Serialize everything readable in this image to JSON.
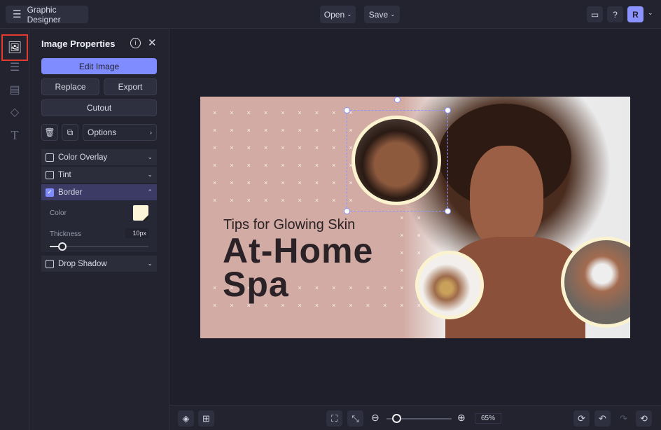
{
  "app": {
    "title": "Graphic Designer",
    "open": "Open",
    "save": "Save",
    "avatar": "R"
  },
  "panel": {
    "title": "Image Properties",
    "edit": "Edit Image",
    "replace": "Replace",
    "export": "Export",
    "cutout": "Cutout",
    "options": "Options",
    "effects": [
      {
        "label": "Color Overlay",
        "checked": false
      },
      {
        "label": "Tint",
        "checked": false
      },
      {
        "label": "Border",
        "checked": true
      },
      {
        "label": "Drop Shadow",
        "checked": false
      }
    ],
    "border": {
      "color_label": "Color",
      "color": "#fdf6d8",
      "thickness_label": "Thickness",
      "thickness": "10px",
      "thickness_value": 10
    }
  },
  "design": {
    "subtitle": "Tips for Glowing Skin",
    "title1": "At-Home",
    "title2": "Spa"
  },
  "zoom": {
    "value": "65%",
    "fraction": 0.1
  },
  "colors": {
    "accent": "#7f8cff",
    "bg": "#1e1f2b",
    "design_bg": "#d2aca4",
    "border": "#fbf3cf"
  }
}
